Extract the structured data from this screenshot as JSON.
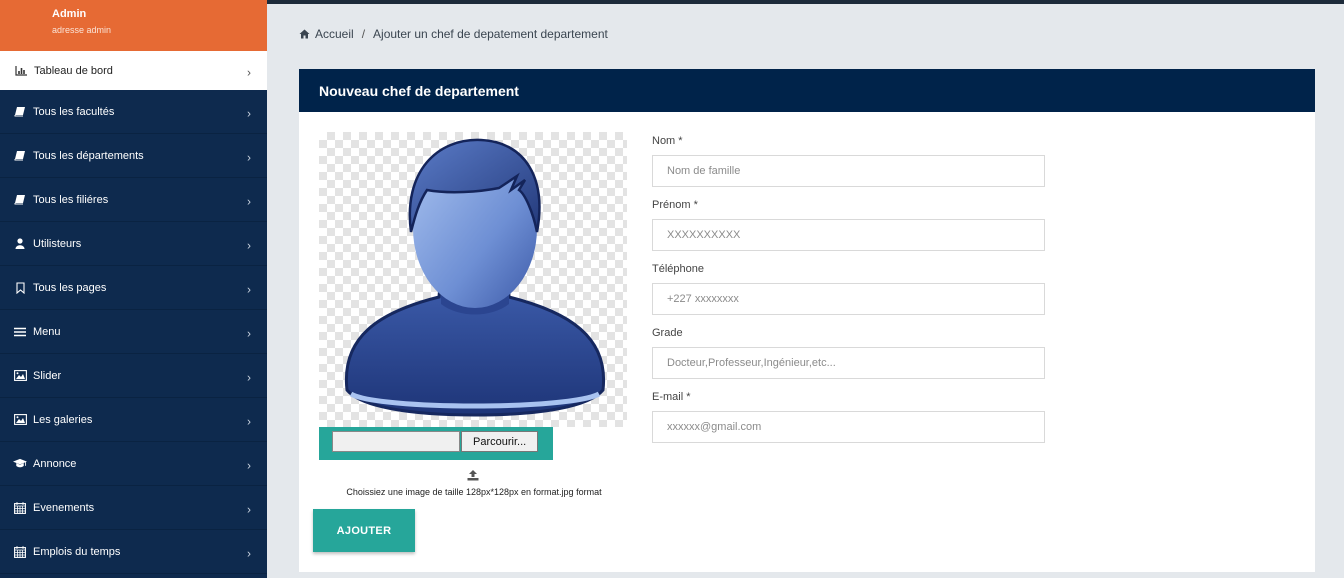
{
  "profile": {
    "name": "Admin",
    "subtitle": "adresse admin"
  },
  "sidebar": {
    "items": [
      {
        "label": "Tableau de bord",
        "icon": "bar-chart-icon",
        "active": true
      },
      {
        "label": "Tous les facultés",
        "icon": "book-icon"
      },
      {
        "label": "Tous les départements",
        "icon": "book-icon"
      },
      {
        "label": "Tous les filiéres",
        "icon": "book-icon"
      },
      {
        "label": "Utilisteurs",
        "icon": "user-icon"
      },
      {
        "label": "Tous les pages",
        "icon": "bookmark-icon"
      },
      {
        "label": "Menu",
        "icon": "menu-icon"
      },
      {
        "label": "Slider",
        "icon": "image-icon"
      },
      {
        "label": "Les galeries",
        "icon": "image-icon"
      },
      {
        "label": "Annonce",
        "icon": "graduation-cap-icon"
      },
      {
        "label": "Evenements",
        "icon": "calendar-icon"
      },
      {
        "label": "Emplois du temps",
        "icon": "calendar-icon"
      }
    ],
    "chevron": "›"
  },
  "breadcrumb": {
    "home": "Accueil",
    "separator": "/",
    "current": "Ajouter un chef de depatement departement"
  },
  "card": {
    "title": "Nouveau chef de departement"
  },
  "upload": {
    "button": "Parcourir...",
    "hint": "Choissiez une image de taille 128px*128px en format.jpg format"
  },
  "form": {
    "fields": [
      {
        "label": "Nom *",
        "placeholder": "Nom de famille"
      },
      {
        "label": "Prénom *",
        "placeholder": "XXXXXXXXXX"
      },
      {
        "label": "Téléphone",
        "placeholder": "+227 xxxxxxxx"
      },
      {
        "label": "Grade",
        "placeholder": "Docteur,Professeur,Ingénieur,etc..."
      },
      {
        "label": "E-mail *",
        "placeholder": "xxxxxx@gmail.com"
      }
    ],
    "submit": "AJOUTER"
  },
  "colors": {
    "sidebar": "#0e2a4e",
    "profile": "#e66a34",
    "header": "#00234a",
    "accent": "#26a69a"
  }
}
